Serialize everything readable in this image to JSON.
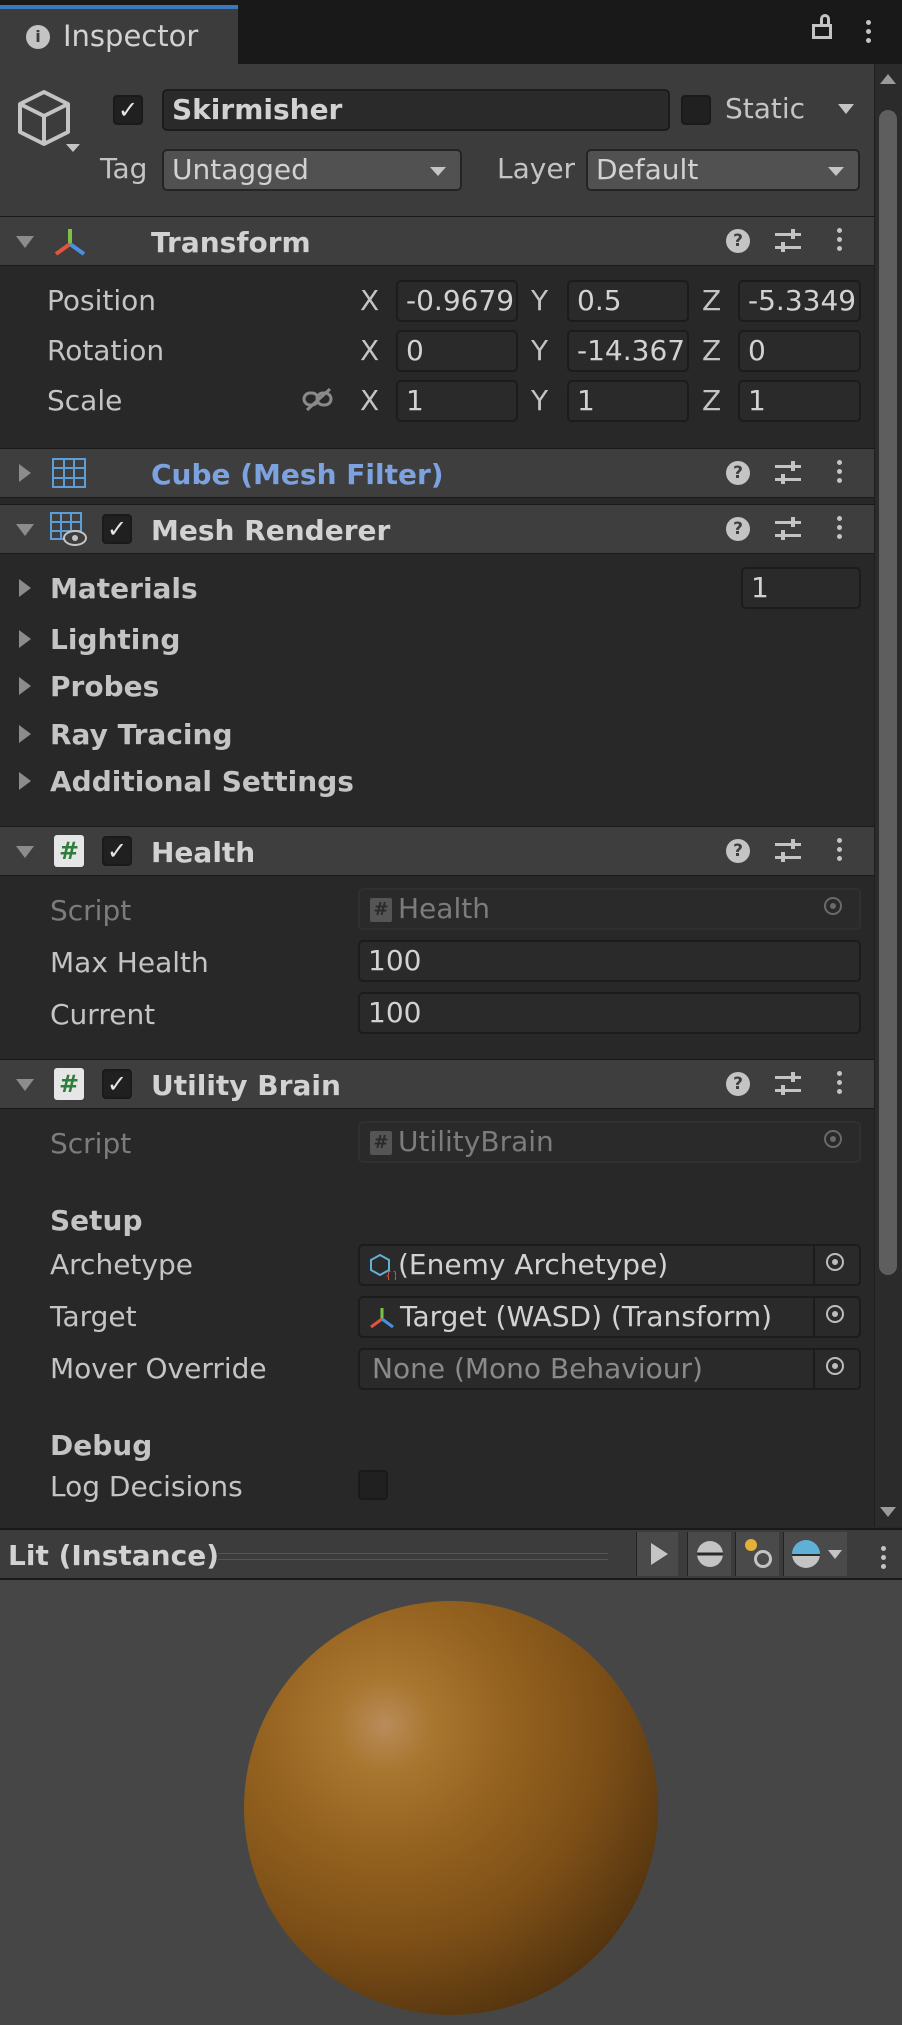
{
  "tab": {
    "label": "Inspector"
  },
  "gameobject": {
    "name": "Skirmisher",
    "active": true,
    "static_label": "Static",
    "tag_label": "Tag",
    "tag_value": "Untagged",
    "layer_label": "Layer",
    "layer_value": "Default"
  },
  "transform": {
    "title": "Transform",
    "position": {
      "label": "Position",
      "x": "-0.9679",
      "y": "0.5",
      "z": "-5.3349"
    },
    "rotation": {
      "label": "Rotation",
      "x": "0",
      "y": "-14.367",
      "z": "0"
    },
    "scale": {
      "label": "Scale",
      "x": "1",
      "y": "1",
      "z": "1"
    },
    "axis_x": "X",
    "axis_y": "Y",
    "axis_z": "Z"
  },
  "mesh_filter": {
    "title": "Cube (Mesh Filter)"
  },
  "mesh_renderer": {
    "title": "Mesh Renderer",
    "enabled": true,
    "materials_label": "Materials",
    "materials_count": "1",
    "lighting_label": "Lighting",
    "probes_label": "Probes",
    "ray_tracing_label": "Ray Tracing",
    "additional_label": "Additional Settings"
  },
  "health": {
    "title": "Health",
    "enabled": true,
    "script_label": "Script",
    "script_value": "Health",
    "max_label": "Max Health",
    "max_value": "100",
    "current_label": "Current",
    "current_value": "100"
  },
  "utility_brain": {
    "title": "Utility Brain",
    "enabled": true,
    "script_label": "Script",
    "script_value": "UtilityBrain",
    "setup_header": "Setup",
    "archetype_label": "Archetype",
    "archetype_value": "(Enemy Archetype)",
    "target_label": "Target",
    "target_value": "Target (WASD) (Transform)",
    "mover_label": "Mover Override",
    "mover_value": "None (Mono Behaviour)",
    "debug_header": "Debug",
    "log_label": "Log Decisions",
    "log_value": false
  },
  "preview": {
    "title": "Lit (Instance)"
  },
  "colors": {
    "accent": "#3a79bb",
    "link_blue": "#7da2e0",
    "material": "#94621f",
    "panel_bg": "#282828"
  }
}
